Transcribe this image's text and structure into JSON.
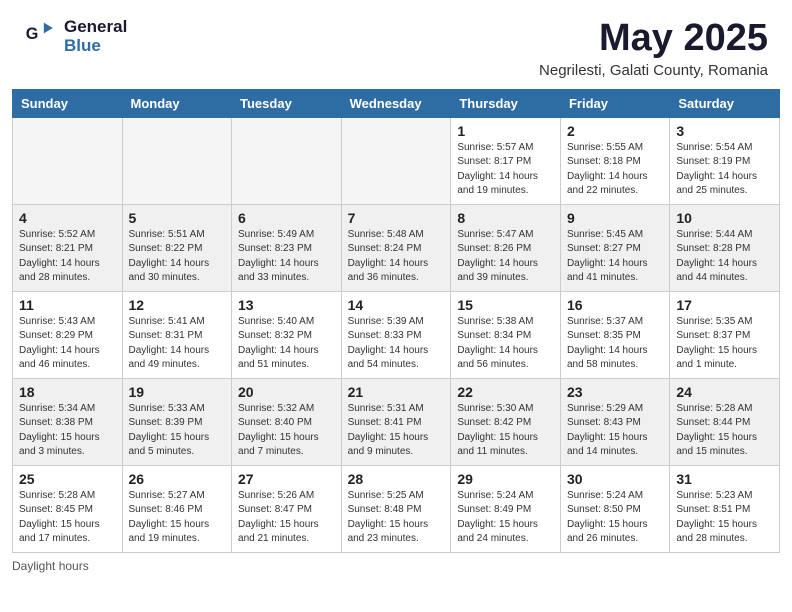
{
  "header": {
    "logo_general": "General",
    "logo_blue": "Blue",
    "month_year": "May 2025",
    "location": "Negrilesti, Galati County, Romania"
  },
  "days": [
    "Sunday",
    "Monday",
    "Tuesday",
    "Wednesday",
    "Thursday",
    "Friday",
    "Saturday"
  ],
  "weeks": [
    [
      {
        "day": "",
        "info": "",
        "empty": true
      },
      {
        "day": "",
        "info": "",
        "empty": true
      },
      {
        "day": "",
        "info": "",
        "empty": true
      },
      {
        "day": "",
        "info": "",
        "empty": true
      },
      {
        "day": "1",
        "info": "Sunrise: 5:57 AM\nSunset: 8:17 PM\nDaylight: 14 hours\nand 19 minutes."
      },
      {
        "day": "2",
        "info": "Sunrise: 5:55 AM\nSunset: 8:18 PM\nDaylight: 14 hours\nand 22 minutes."
      },
      {
        "day": "3",
        "info": "Sunrise: 5:54 AM\nSunset: 8:19 PM\nDaylight: 14 hours\nand 25 minutes."
      }
    ],
    [
      {
        "day": "4",
        "info": "Sunrise: 5:52 AM\nSunset: 8:21 PM\nDaylight: 14 hours\nand 28 minutes."
      },
      {
        "day": "5",
        "info": "Sunrise: 5:51 AM\nSunset: 8:22 PM\nDaylight: 14 hours\nand 30 minutes."
      },
      {
        "day": "6",
        "info": "Sunrise: 5:49 AM\nSunset: 8:23 PM\nDaylight: 14 hours\nand 33 minutes."
      },
      {
        "day": "7",
        "info": "Sunrise: 5:48 AM\nSunset: 8:24 PM\nDaylight: 14 hours\nand 36 minutes."
      },
      {
        "day": "8",
        "info": "Sunrise: 5:47 AM\nSunset: 8:26 PM\nDaylight: 14 hours\nand 39 minutes."
      },
      {
        "day": "9",
        "info": "Sunrise: 5:45 AM\nSunset: 8:27 PM\nDaylight: 14 hours\nand 41 minutes."
      },
      {
        "day": "10",
        "info": "Sunrise: 5:44 AM\nSunset: 8:28 PM\nDaylight: 14 hours\nand 44 minutes."
      }
    ],
    [
      {
        "day": "11",
        "info": "Sunrise: 5:43 AM\nSunset: 8:29 PM\nDaylight: 14 hours\nand 46 minutes."
      },
      {
        "day": "12",
        "info": "Sunrise: 5:41 AM\nSunset: 8:31 PM\nDaylight: 14 hours\nand 49 minutes."
      },
      {
        "day": "13",
        "info": "Sunrise: 5:40 AM\nSunset: 8:32 PM\nDaylight: 14 hours\nand 51 minutes."
      },
      {
        "day": "14",
        "info": "Sunrise: 5:39 AM\nSunset: 8:33 PM\nDaylight: 14 hours\nand 54 minutes."
      },
      {
        "day": "15",
        "info": "Sunrise: 5:38 AM\nSunset: 8:34 PM\nDaylight: 14 hours\nand 56 minutes."
      },
      {
        "day": "16",
        "info": "Sunrise: 5:37 AM\nSunset: 8:35 PM\nDaylight: 14 hours\nand 58 minutes."
      },
      {
        "day": "17",
        "info": "Sunrise: 5:35 AM\nSunset: 8:37 PM\nDaylight: 15 hours\nand 1 minute."
      }
    ],
    [
      {
        "day": "18",
        "info": "Sunrise: 5:34 AM\nSunset: 8:38 PM\nDaylight: 15 hours\nand 3 minutes."
      },
      {
        "day": "19",
        "info": "Sunrise: 5:33 AM\nSunset: 8:39 PM\nDaylight: 15 hours\nand 5 minutes."
      },
      {
        "day": "20",
        "info": "Sunrise: 5:32 AM\nSunset: 8:40 PM\nDaylight: 15 hours\nand 7 minutes."
      },
      {
        "day": "21",
        "info": "Sunrise: 5:31 AM\nSunset: 8:41 PM\nDaylight: 15 hours\nand 9 minutes."
      },
      {
        "day": "22",
        "info": "Sunrise: 5:30 AM\nSunset: 8:42 PM\nDaylight: 15 hours\nand 11 minutes."
      },
      {
        "day": "23",
        "info": "Sunrise: 5:29 AM\nSunset: 8:43 PM\nDaylight: 15 hours\nand 14 minutes."
      },
      {
        "day": "24",
        "info": "Sunrise: 5:28 AM\nSunset: 8:44 PM\nDaylight: 15 hours\nand 15 minutes."
      }
    ],
    [
      {
        "day": "25",
        "info": "Sunrise: 5:28 AM\nSunset: 8:45 PM\nDaylight: 15 hours\nand 17 minutes."
      },
      {
        "day": "26",
        "info": "Sunrise: 5:27 AM\nSunset: 8:46 PM\nDaylight: 15 hours\nand 19 minutes."
      },
      {
        "day": "27",
        "info": "Sunrise: 5:26 AM\nSunset: 8:47 PM\nDaylight: 15 hours\nand 21 minutes."
      },
      {
        "day": "28",
        "info": "Sunrise: 5:25 AM\nSunset: 8:48 PM\nDaylight: 15 hours\nand 23 minutes."
      },
      {
        "day": "29",
        "info": "Sunrise: 5:24 AM\nSunset: 8:49 PM\nDaylight: 15 hours\nand 24 minutes."
      },
      {
        "day": "30",
        "info": "Sunrise: 5:24 AM\nSunset: 8:50 PM\nDaylight: 15 hours\nand 26 minutes."
      },
      {
        "day": "31",
        "info": "Sunrise: 5:23 AM\nSunset: 8:51 PM\nDaylight: 15 hours\nand 28 minutes."
      }
    ]
  ],
  "footer": {
    "daylight_label": "Daylight hours"
  }
}
